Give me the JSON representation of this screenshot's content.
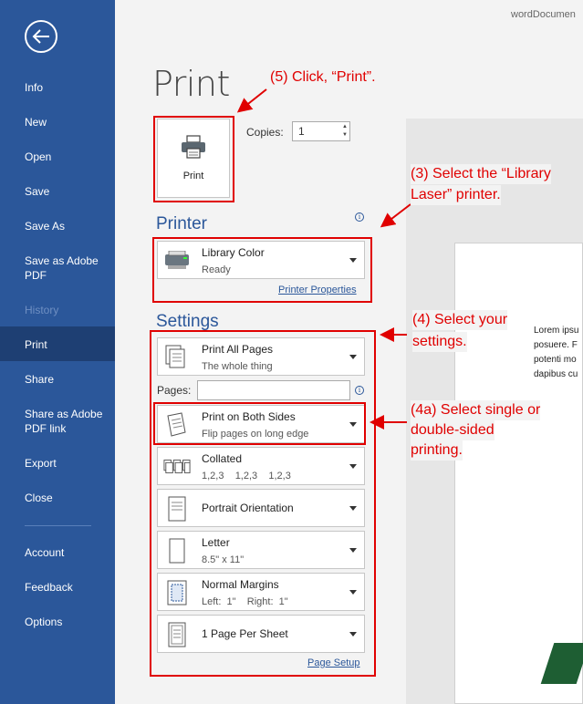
{
  "window": {
    "file_name": "wordDocumen"
  },
  "sidebar": {
    "items": [
      {
        "label": "Info"
      },
      {
        "label": "New"
      },
      {
        "label": "Open"
      },
      {
        "label": "Save"
      },
      {
        "label": "Save As"
      },
      {
        "label": "Save as Adobe PDF"
      },
      {
        "label": "History"
      },
      {
        "label": "Print"
      },
      {
        "label": "Share"
      },
      {
        "label": "Share as Adobe PDF link"
      },
      {
        "label": "Export"
      },
      {
        "label": "Close"
      },
      {
        "label": "Account"
      },
      {
        "label": "Feedback"
      },
      {
        "label": "Options"
      }
    ],
    "active": "Print",
    "disabled": "History"
  },
  "main": {
    "title": "Print",
    "print_button": "Print",
    "copies_label": "Copies:",
    "copies_value": "1",
    "printer_heading": "Printer",
    "printer": {
      "name": "Library Color",
      "status": "Ready"
    },
    "printer_properties": "Printer Properties",
    "settings_heading": "Settings",
    "settings": [
      {
        "title": "Print All Pages",
        "sub": "The whole thing"
      },
      {
        "title": "Print on Both Sides",
        "sub": "Flip pages on long edge"
      },
      {
        "title": "Collated",
        "sub": "1,2,3    1,2,3    1,2,3"
      },
      {
        "title": "Portrait Orientation",
        "sub": ""
      },
      {
        "title": "Letter",
        "sub": "8.5\" x 11\""
      },
      {
        "title": "Normal Margins",
        "sub": "Left:  1\"    Right:  1\""
      },
      {
        "title": "1 Page Per Sheet",
        "sub": ""
      }
    ],
    "pages_label": "Pages:",
    "page_setup": "Page Setup"
  },
  "preview": {
    "text": "Lorem ipsu\nposuere. F\npotenti mo\ndapibus cu"
  },
  "annotations": {
    "a5": "(5) Click, “Print”.",
    "a3_line1": "(3) Select the “Library",
    "a3_line2": "Laser” printer.",
    "a4_line1": "(4) Select your",
    "a4_line2": "settings.",
    "a4a_line1": "(4a) Select single or",
    "a4a_line2": "double-sided",
    "a4a_line3": "printing."
  },
  "colors": {
    "sidebar": "#2b579a",
    "annotation": "#e00000",
    "accent": "#2b579a"
  }
}
